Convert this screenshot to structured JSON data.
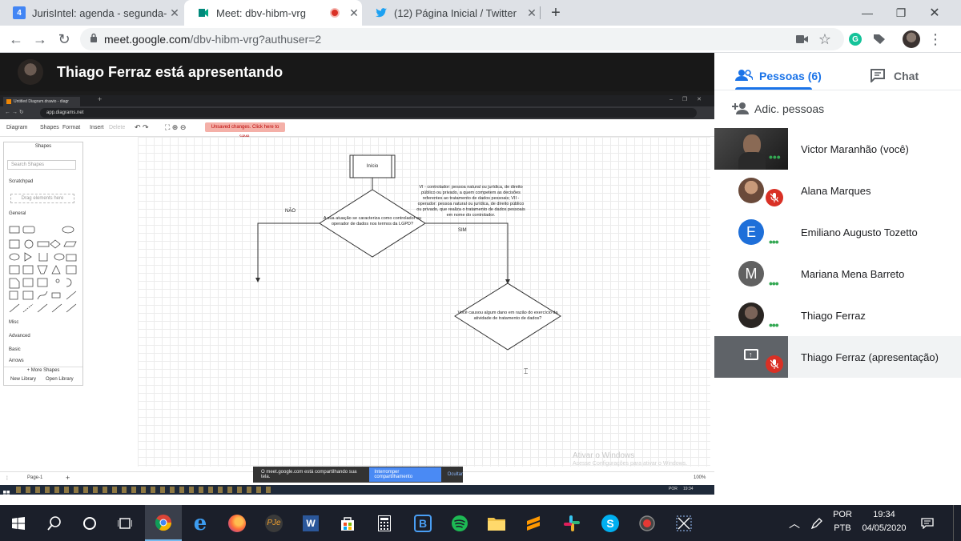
{
  "browser": {
    "tabs": [
      {
        "title": "JurisIntel: agenda - segunda-feira",
        "favicon": "calendar-icon",
        "favicon_color": "#4285f4",
        "badge": "4"
      },
      {
        "title": "Meet: dbv-hibm-vrg",
        "favicon": "meet-icon",
        "favicon_color": "#00897b",
        "recording": true
      },
      {
        "title": "(12) Página Inicial / Twitter",
        "favicon": "twitter-icon",
        "favicon_color": "#1da1f2"
      }
    ],
    "url": {
      "host": "meet.google.com",
      "path": "/dbv-hibm-vrg?authuser=2"
    }
  },
  "presenter": {
    "text": "Thiago Ferraz está apresentando"
  },
  "shared_screen": {
    "inner_tab_title": "Untitled Diagram.drawio - diagr",
    "inner_url": "app.diagrams.net",
    "menu": [
      "Diagram",
      "Shapes",
      "Format",
      "Insert",
      "Delete"
    ],
    "unsaved": "Unsaved changes. Click here to save.",
    "shapes_panel": {
      "title": "Shapes",
      "search_placeholder": "Search Shapes",
      "scratchpad": "Scratchpad",
      "drag_hint": "Drag elements here",
      "sections": [
        "General",
        "Misc",
        "Advanced",
        "Basic",
        "Arrows"
      ],
      "more_shapes": "+ More Shapes",
      "new_library": "New Library",
      "open_library": "Open Library"
    },
    "diagram": {
      "start": "Início",
      "decision1": "A sua atuação se caracteriza como controlador ou operador de dados nos termos da LGPD?",
      "no_label": "NÃO",
      "yes_label": "SIM",
      "note": "VI - controlador: pessoa natural ou jurídica, de direito público ou privado, a quem competem as decisões referentes ao tratamento de dados pessoais; VII - operador: pessoa natural ou jurídica, de direito público ou privado, que realiza o tratamento de dados pessoais em nome do controlador.",
      "decision2": "Você causou algum dano em razão do exercício da atividade de tratamento de dados?"
    },
    "page_tab": "Page-1",
    "zoom": "100%",
    "share_notice": "O meet.google.com está compartilhando sua tela.",
    "share_stop": "Interromper compartilhamento",
    "share_hide": "Ocultar",
    "watermark_title": "Ativar o Windows",
    "watermark_sub": "Acesse Configurações para ativar o Windows.",
    "inner_clock": "19:34",
    "inner_lang": "POR"
  },
  "panel": {
    "people_tab": "Pessoas (6)",
    "chat_tab": "Chat",
    "add_people": "Adic. pessoas",
    "people": [
      {
        "name": "Victor Maranhão (você)",
        "initial": "",
        "tile": "video",
        "status": "speaking"
      },
      {
        "name": "Alana Marques",
        "initial": "",
        "tile": "photo",
        "status": "muted"
      },
      {
        "name": "Emiliano Augusto Tozetto",
        "initial": "E",
        "color": "#1e6fd9",
        "status": "speaking"
      },
      {
        "name": "Mariana Mena Barreto",
        "initial": "M",
        "color": "#616161",
        "status": "speaking"
      },
      {
        "name": "Thiago Ferraz",
        "initial": "",
        "tile": "photo",
        "status": "speaking"
      },
      {
        "name": "Thiago Ferraz (apresentação)",
        "initial": "",
        "tile": "presentation",
        "status": "muted"
      }
    ]
  },
  "taskbar": {
    "lang1": "POR",
    "lang2": "PTB",
    "time": "19:34",
    "date": "04/05/2020",
    "apps": [
      "windows-start",
      "search",
      "cortana",
      "task-view",
      "chrome",
      "edge",
      "firefox",
      "pje",
      "word",
      "store",
      "calculator",
      "bluetooth",
      "spotify",
      "explorer",
      "sublime",
      "slack",
      "skype",
      "recorder",
      "snipping"
    ]
  },
  "colors": {
    "accent": "#1a73e8",
    "muted_red": "#d93025",
    "active_green": "#34a853"
  }
}
